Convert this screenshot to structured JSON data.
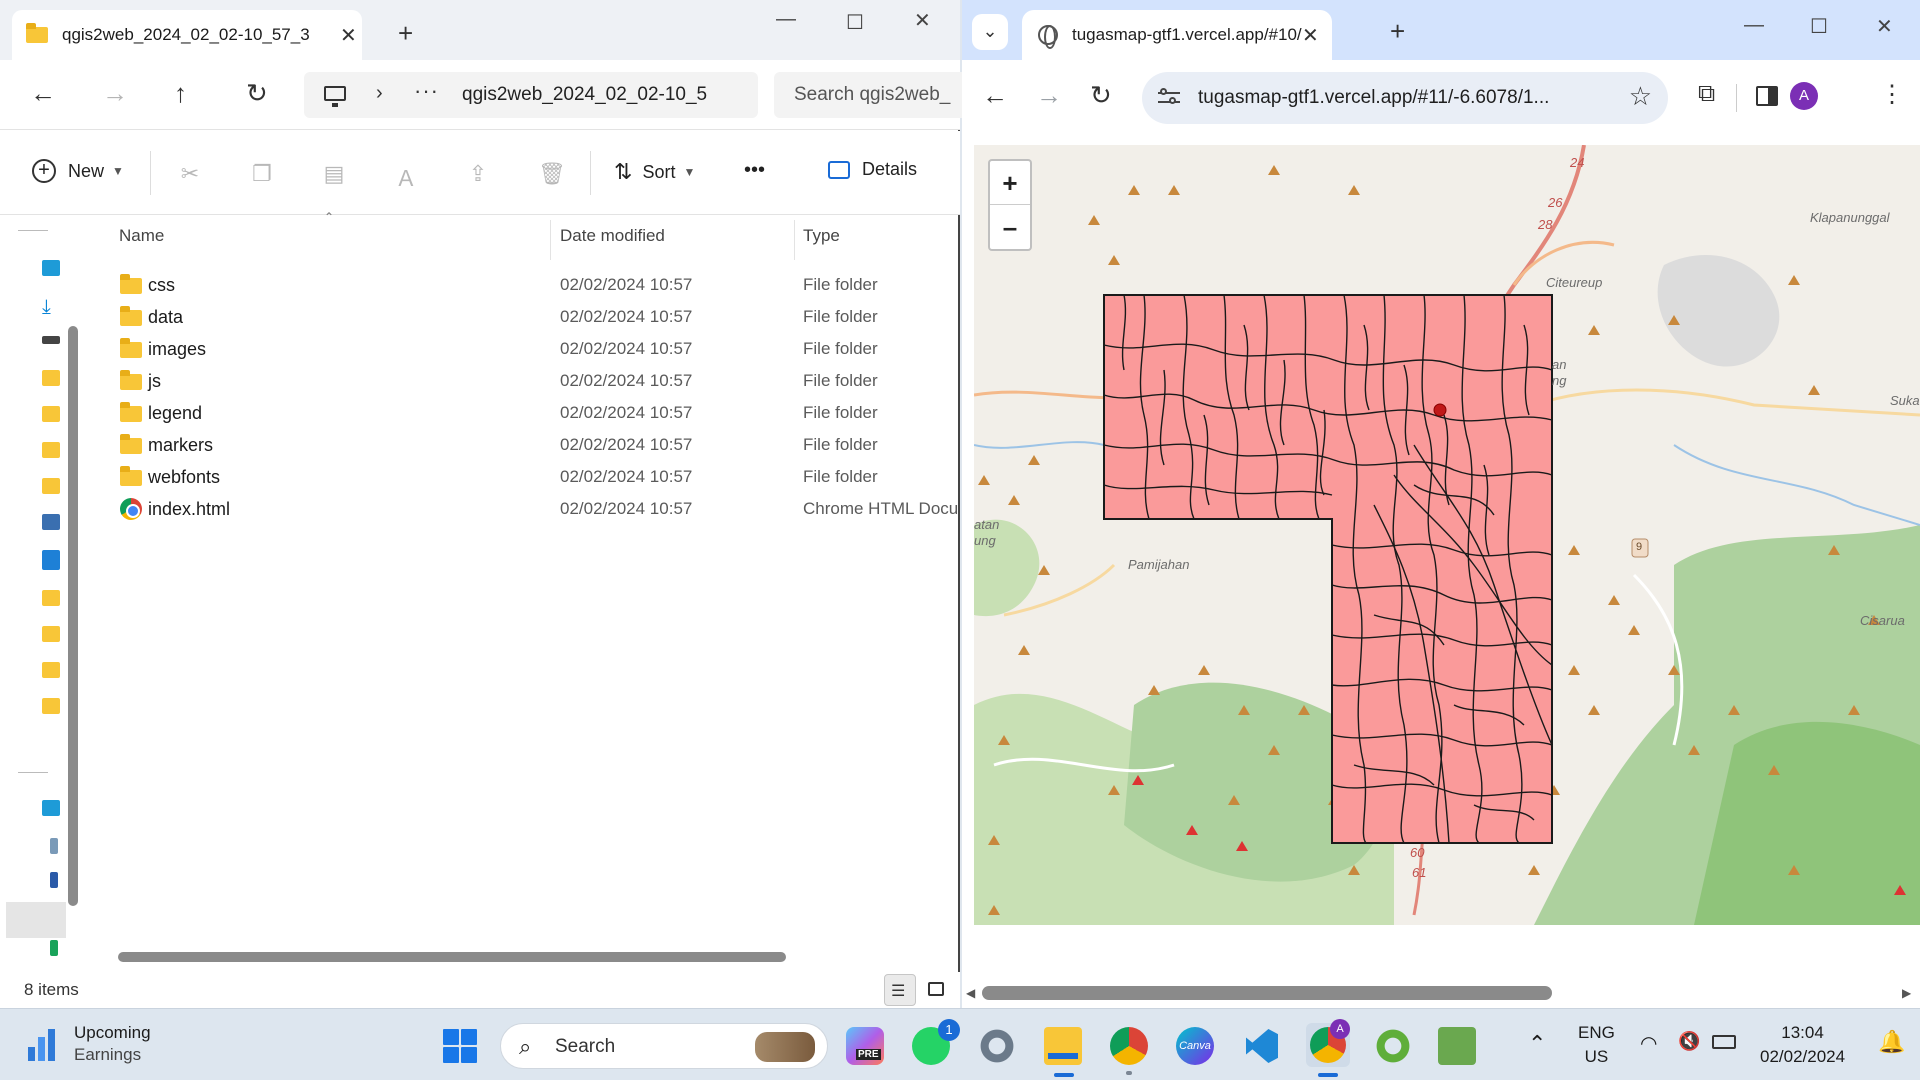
{
  "explorer": {
    "tab_title": "qgis2web_2024_02_02-10_57_3",
    "address_path": "qgis2web_2024_02_02-10_5",
    "search_placeholder": "Search qgis2web_",
    "toolbar": {
      "new_label": "New",
      "sort_label": "Sort",
      "more_label": "•••",
      "details_label": "Details"
    },
    "columns": {
      "name": "Name",
      "date": "Date modified",
      "type": "Type"
    },
    "files": [
      {
        "name": "css",
        "date": "02/02/2024 10:57",
        "type": "File folder",
        "icon": "folder-icon"
      },
      {
        "name": "data",
        "date": "02/02/2024 10:57",
        "type": "File folder",
        "icon": "folder-icon"
      },
      {
        "name": "images",
        "date": "02/02/2024 10:57",
        "type": "File folder",
        "icon": "folder-icon"
      },
      {
        "name": "js",
        "date": "02/02/2024 10:57",
        "type": "File folder",
        "icon": "folder-icon"
      },
      {
        "name": "legend",
        "date": "02/02/2024 10:57",
        "type": "File folder",
        "icon": "folder-icon"
      },
      {
        "name": "markers",
        "date": "02/02/2024 10:57",
        "type": "File folder",
        "icon": "folder-icon"
      },
      {
        "name": "webfonts",
        "date": "02/02/2024 10:57",
        "type": "File folder",
        "icon": "folder-icon"
      },
      {
        "name": "index.html",
        "date": "02/02/2024 10:57",
        "type": "Chrome HTML Docu",
        "icon": "chrome-icon"
      }
    ],
    "status_count": "8 items"
  },
  "browser": {
    "tab_title": "tugasmap-gtf1.vercel.app/#10/",
    "url": "tugasmap-gtf1.vercel.app/#11/-6.6078/1...",
    "avatar_letter": "A",
    "map": {
      "zoom_in": "+",
      "zoom_out": "–",
      "labels": [
        "Klapanunggal",
        "Citeureup",
        "Pamijahan",
        "Cisarua",
        "Suka",
        "atan",
        "ung",
        "an",
        "ng",
        "24",
        "26",
        "28",
        "9",
        "61",
        "60"
      ],
      "polygon_fill": "#fa9a9a",
      "polygon_stroke": "#1a1a1a"
    }
  },
  "taskbar": {
    "weather_title": "Upcoming",
    "weather_sub": "Earnings",
    "search_label": "Search",
    "whatsapp_badge": "1",
    "lang_line1": "ENG",
    "lang_line2": "US",
    "time": "13:04",
    "date": "02/02/2024"
  },
  "colors": {
    "accent": "#1a6bd6",
    "chrome_tab_bg": "#d3e3fd",
    "folder": "#f8c638"
  }
}
